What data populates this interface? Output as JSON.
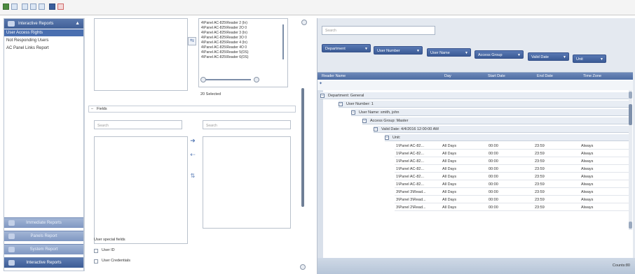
{
  "sidebar": {
    "header": "Interactive Reports",
    "items": [
      {
        "label": "User Access Rights"
      },
      {
        "label": "Not Responding Users"
      },
      {
        "label": "AC Panel Links Report"
      }
    ],
    "buttons": [
      {
        "label": "Immediate Reports"
      },
      {
        "label": "Panels Report"
      },
      {
        "label": "System Report"
      },
      {
        "label": "Interactive Reports"
      }
    ]
  },
  "readers": {
    "items": [
      "4\\Panel AC-825\\Reader 2 (In)",
      "4\\Panel AC-825\\Reader 2O 0",
      "4\\Panel AC-825\\Reader 3 (In)",
      "4\\Panel AC-825\\Reader 3O 0",
      "4\\Panel AC-825\\Reader 4 (In)",
      "4\\Panel AC-825\\Reader 4O 0",
      "4\\Panel AC-825\\Reader 5(OS)",
      "4\\Panel AC-825\\Reader 6(OS)"
    ],
    "selected_count": "20 Selected"
  },
  "fields": {
    "label": "Fields",
    "search_left": "Search",
    "search_right": "Search"
  },
  "special_fields": {
    "label": "User special fields",
    "options": [
      {
        "label": "User ID"
      },
      {
        "label": "User Credentials"
      }
    ]
  },
  "grid": {
    "search_placeholder": "Search",
    "filters": [
      {
        "label": "Department"
      },
      {
        "label": "User Number"
      },
      {
        "label": "User Name"
      },
      {
        "label": "Access Group"
      },
      {
        "label": "Valid Date"
      },
      {
        "label": "Unit"
      }
    ],
    "columns": [
      "Reader Name",
      "Day",
      "Start Date",
      "End Date",
      "Time Zone"
    ],
    "groups": [
      {
        "text": "Department: General"
      },
      {
        "text": "User Number: 1"
      },
      {
        "text": "User Name: smith, john"
      },
      {
        "text": "Access Group: Master"
      },
      {
        "text": "Valid Date: 4/4/2016 12:00:00 AM"
      },
      {
        "text": "Unit:"
      }
    ],
    "rows": [
      [
        "1\\Panel AC-82...",
        "All Days",
        "00:00",
        "23:59",
        "Always"
      ],
      [
        "1\\Panel AC-82...",
        "All Days",
        "00:00",
        "23:59",
        "Always"
      ],
      [
        "1\\Panel AC-82...",
        "All Days",
        "00:00",
        "23:59",
        "Always"
      ],
      [
        "1\\Panel AC-82...",
        "All Days",
        "00:00",
        "23:59",
        "Always"
      ],
      [
        "1\\Panel AC-82...",
        "All Days",
        "00:00",
        "23:59",
        "Always"
      ],
      [
        "1\\Panel AC-82...",
        "All Days",
        "00:00",
        "23:59",
        "Always"
      ],
      [
        "3\\Panel 3\\Read...",
        "All Days",
        "00:00",
        "23:59",
        "Always"
      ],
      [
        "3\\Panel 3\\Read...",
        "All Days",
        "00:00",
        "23:59",
        "Always"
      ],
      [
        "3\\Panel 2\\Read...",
        "All Days",
        "00:00",
        "23:59",
        "Always"
      ]
    ],
    "footer_count": "Counts:80"
  }
}
